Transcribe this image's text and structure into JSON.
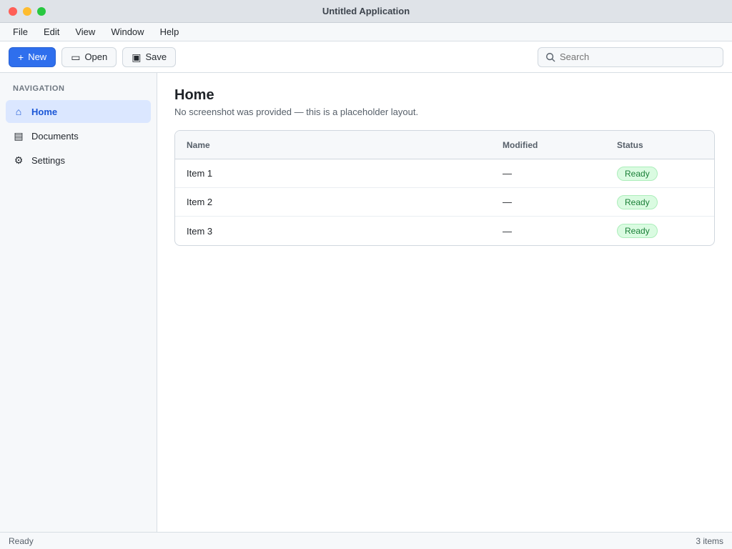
{
  "window": {
    "title": "Untitled Application"
  },
  "menu": [
    "File",
    "Edit",
    "View",
    "Window",
    "Help"
  ],
  "toolbar": {
    "new_label": "New",
    "open_label": "Open",
    "save_label": "Save",
    "search_placeholder": "Search"
  },
  "sidebar": {
    "heading": "Navigation",
    "items": [
      {
        "label": "Home",
        "icon": "home-icon",
        "glyph": "⌂"
      },
      {
        "label": "Documents",
        "icon": "document-icon",
        "glyph": "▤"
      },
      {
        "label": "Settings",
        "icon": "gear-icon",
        "glyph": "⚙"
      }
    ]
  },
  "main": {
    "title": "Home",
    "subtitle": "No screenshot was provided — this is a placeholder layout.",
    "columns": [
      "Name",
      "Modified",
      "Status"
    ],
    "rows": [
      {
        "name": "Item 1",
        "modified": "—",
        "status": "Ready"
      },
      {
        "name": "Item 2",
        "modified": "—",
        "status": "Ready"
      },
      {
        "name": "Item 3",
        "modified": "—",
        "status": "Ready"
      }
    ]
  },
  "status": {
    "left": "Ready",
    "right": "3 items"
  },
  "colors": {
    "accent": "#2f6fed",
    "active_bg": "#dbe7ff",
    "success": "#1a7f37"
  }
}
